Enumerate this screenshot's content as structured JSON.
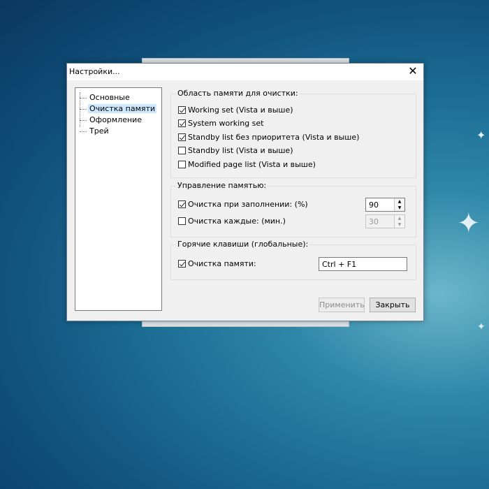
{
  "window": {
    "title": "Настройки...",
    "close_glyph": "✕"
  },
  "tree": {
    "items": [
      {
        "label": "Основные",
        "selected": false
      },
      {
        "label": "Очистка памяти",
        "selected": true
      },
      {
        "label": "Оформление",
        "selected": false
      },
      {
        "label": "Трей",
        "selected": false
      }
    ]
  },
  "memory_area": {
    "title": "Область памяти для очистки:",
    "options": [
      {
        "label": "Working set (Vista и выше)",
        "checked": true
      },
      {
        "label": "System working set",
        "checked": true
      },
      {
        "label": "Standby list без приоритета (Vista и выше)",
        "checked": true
      },
      {
        "label": "Standby list (Vista и выше)",
        "checked": false
      },
      {
        "label": "Modified page list (Vista и выше)",
        "checked": false
      }
    ]
  },
  "memory_management": {
    "title": "Управление памятью:",
    "on_fill": {
      "label": "Очистка при заполнении: (%)",
      "checked": true,
      "value": "90"
    },
    "every": {
      "label": "Очистка каждые: (мин.)",
      "checked": false,
      "value": "30"
    }
  },
  "hotkeys": {
    "title": "Горячие клавиши (глобальные):",
    "clean": {
      "label": "Очистка памяти:",
      "checked": true,
      "value": "Ctrl + F1"
    }
  },
  "buttons": {
    "apply": "Применить",
    "close": "Закрыть"
  },
  "icons": {
    "sparkle": "✦",
    "spin_up": "▲",
    "spin_down": "▼"
  }
}
